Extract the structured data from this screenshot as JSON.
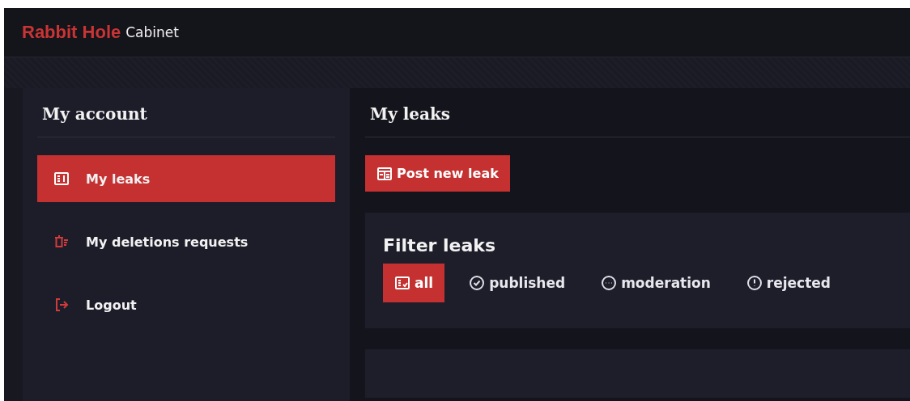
{
  "header": {
    "brand": "Rabbit Hole",
    "subtitle": "Cabinet"
  },
  "sidebar": {
    "title": "My account",
    "items": [
      {
        "label": "My leaks",
        "kind": "leaks",
        "selected": true
      },
      {
        "label": "My deletions requests",
        "kind": "deletions",
        "selected": false
      },
      {
        "label": "Logout",
        "kind": "logout",
        "selected": false
      }
    ]
  },
  "main": {
    "title": "My leaks",
    "button": "Post new leak",
    "filter": {
      "title": "Filter leaks",
      "options": [
        {
          "label": "all",
          "kind": "all",
          "selected": true
        },
        {
          "label": "published",
          "kind": "published",
          "selected": false
        },
        {
          "label": "moderation",
          "kind": "moderation",
          "selected": false
        },
        {
          "label": "rejected",
          "kind": "rejected",
          "selected": false
        }
      ]
    }
  }
}
